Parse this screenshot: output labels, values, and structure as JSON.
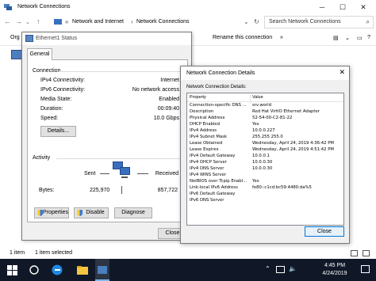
{
  "explorer": {
    "title": "Network Connections",
    "breadcrumbs": [
      "Network and Internet",
      "Network Connections"
    ],
    "search_placeholder": "Search Network Connections",
    "cmd": {
      "organize": "Org",
      "rename": "Rename this connection",
      "more": "»"
    },
    "status": {
      "items": "1 item",
      "selected": "1 item selected"
    }
  },
  "eth_status": {
    "title": "Ethernet1 Status",
    "tab": "General",
    "connection_group": "Connection",
    "rows": [
      {
        "label": "IPv4 Connectivity:",
        "value": "Internet"
      },
      {
        "label": "IPv6 Connectivity:",
        "value": "No network access"
      },
      {
        "label": "Media State:",
        "value": "Enabled"
      },
      {
        "label": "Duration:",
        "value": "00:09:40"
      },
      {
        "label": "Speed:",
        "value": "10.0 Gbps"
      }
    ],
    "details_button": "Details...",
    "activity_group": "Activity",
    "sent_label": "Sent",
    "received_label": "Received",
    "bytes_label": "Bytes:",
    "bytes_sent": "225,970",
    "bytes_received": "857,722",
    "properties_button": "Properties",
    "disable_button": "Disable",
    "diagnose_button": "Diagnose",
    "close_button": "Close"
  },
  "details": {
    "title": "Network Connection Details",
    "subtitle": "Network Connection Details:",
    "col_property": "Property",
    "col_value": "Value",
    "rows": [
      {
        "property": "Connection-specific DNS ...",
        "value": "srv.world"
      },
      {
        "property": "Description",
        "value": "Red Hat VirtIO Ethernet Adapter"
      },
      {
        "property": "Physical Address",
        "value": "52-54-00-C2-81-22"
      },
      {
        "property": "DHCP Enabled",
        "value": "Yes"
      },
      {
        "property": "IPv4 Address",
        "value": "10.0.0.227"
      },
      {
        "property": "IPv4 Subnet Mask",
        "value": "255.255.255.0"
      },
      {
        "property": "Lease Obtained",
        "value": "Wednesday, April 24, 2019 4:36:42 PM"
      },
      {
        "property": "Lease Expires",
        "value": "Wednesday, April 24, 2019 4:51:42 PM"
      },
      {
        "property": "IPv4 Default Gateway",
        "value": "10.0.0.1"
      },
      {
        "property": "IPv4 DHCP Server",
        "value": "10.0.0.30"
      },
      {
        "property": "IPv4 DNS Server",
        "value": "10.0.0.30"
      },
      {
        "property": "IPv4 WINS Server",
        "value": ""
      },
      {
        "property": "NetBIOS over Tcpip Enabl...",
        "value": "Yes"
      },
      {
        "property": "Link-local IPv6 Address",
        "value": "fe80::c1cd:bc59:4480:da%5"
      },
      {
        "property": "IPv6 Default Gateway",
        "value": ""
      },
      {
        "property": "IPv6 DNS Server",
        "value": ""
      }
    ],
    "close_button": "Close"
  },
  "taskbar": {
    "time": "4:45 PM",
    "date": "4/24/2019"
  },
  "colors": {
    "accent": "#0078d7",
    "taskbar": "#101828",
    "dialog_bg": "#f0f0f0"
  }
}
